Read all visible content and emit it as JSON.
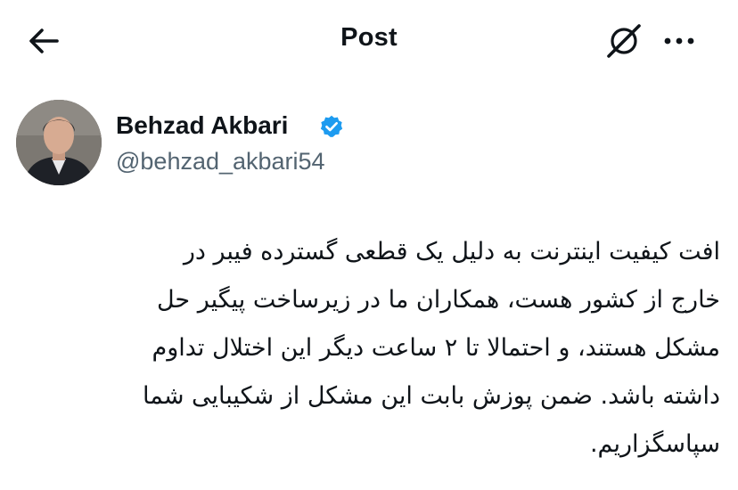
{
  "header": {
    "title": "Post",
    "back_icon": "arrow-left-icon",
    "grok_icon": "grok-icon",
    "more_icon": "more-horizontal-icon"
  },
  "author": {
    "name": "Behzad Akbari",
    "handle": "@behzad_akbari54",
    "verified": true,
    "verified_color": "#1d9bf0",
    "avatar_icon": "avatar"
  },
  "post": {
    "lines": [
      "افت کیفیت اینترنت به دلیل یک قطعی گسترده فیبر در",
      "خارج از کشور هست، همکاران ما در زیرساخت پیگیر حل",
      "مشکل هستند، و احتمالا تا ۲ ساعت دیگر این اختلال تداوم",
      "داشته باشد. ضمن پوزش بابت این مشکل از شکیبایی شما",
      "سپاسگزاریم."
    ]
  },
  "colors": {
    "text": "#0f1419",
    "secondary": "#536471",
    "background": "#ffffff"
  }
}
